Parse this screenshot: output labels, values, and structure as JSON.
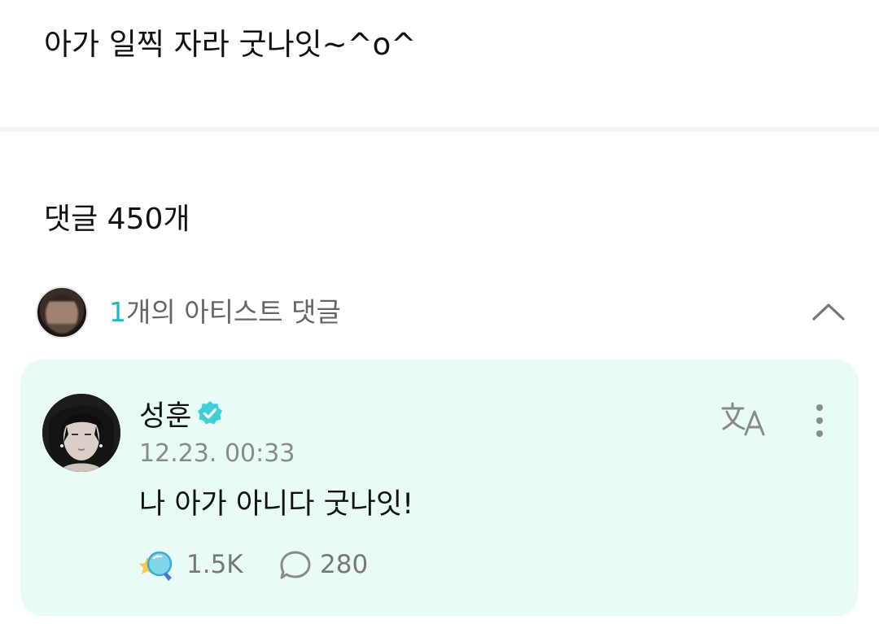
{
  "post": {
    "text": "아가 일찍 자라 굿나잇~^o^"
  },
  "comments_header": {
    "count_label": "댓글 450개"
  },
  "artist_comments": {
    "count": "1",
    "label": "개의 아티스트 댓글",
    "toggle_icon": "chevron-up-icon"
  },
  "comment": {
    "author": "성훈",
    "verified_icon": "verified-badge-icon",
    "timestamp": "12.23. 00:33",
    "body": "나 아가 아니다 굿나잇!",
    "likes": "1.5K",
    "replies": "280",
    "translate_icon": "translate-icon",
    "more_icon": "more-vertical-icon"
  },
  "colors": {
    "accent": "#1fb8c0",
    "card_background": "#e8fbf7",
    "verified": "#3fd0d6"
  }
}
